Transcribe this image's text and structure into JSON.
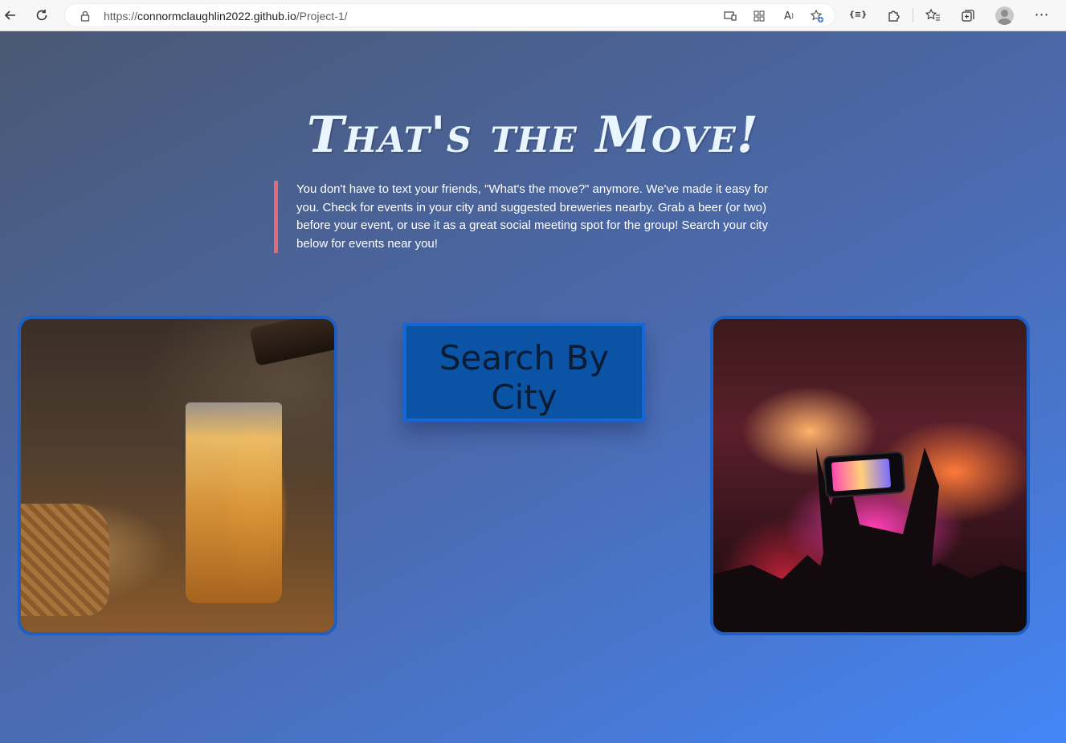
{
  "browser": {
    "url_prefix": "https://",
    "url_host": "connormclaughlin2022.github.io",
    "url_path": "/Project-1/",
    "icons": {
      "back": "arrow-left-icon",
      "refresh": "refresh-icon",
      "lock": "lock-icon",
      "app_available": "app-available-icon",
      "grid": "grid-icon",
      "read_aloud": "read-aloud-icon",
      "favorite": "star-plus-icon",
      "extension_json": "json-extension-icon",
      "extensions": "puzzle-icon",
      "favorites": "favorites-icon",
      "collections": "collections-icon",
      "profile": "profile-icon",
      "menu": "more-icon"
    },
    "json_ext_label": "{≡}"
  },
  "page": {
    "title": "That's the Move!",
    "intro": "You don't have to text your friends, \"What's the move?\" anymore. We've made it easy for you. Check for events in your city and suggested breweries nearby. Grab a beer (or two) before your event, or use it as a great social meeting spot for the group! Search your city below for events near you!",
    "search_button": "Search By City",
    "images": {
      "left": "beer-pour-photo",
      "right": "concert-crowd-photo"
    },
    "colors": {
      "accent_border": "#e06b74",
      "button_bg": "#0b54a5",
      "image_border": "#1f5fc2"
    }
  }
}
